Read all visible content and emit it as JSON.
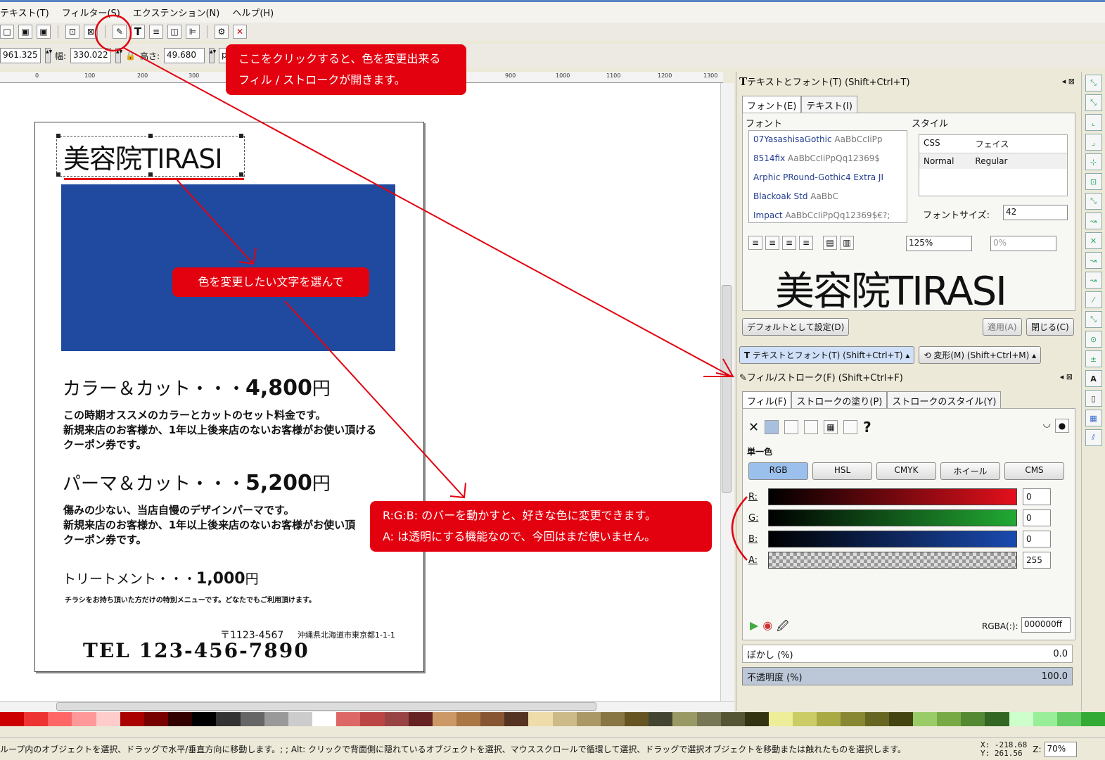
{
  "menu": [
    "テキスト(T)",
    "フィルター(S)",
    "エクステンション(N)",
    "ヘルプ(H)"
  ],
  "ctrl": {
    "x_value": "961.325",
    "w_label": "幅:",
    "w_value": "330.022",
    "h_label": "高さ:",
    "h_value": "49.680",
    "unit": "px"
  },
  "ruler": [
    "0",
    "100",
    "200",
    "300",
    "900",
    "1000",
    "1100",
    "1200",
    "1300"
  ],
  "flyer": {
    "title": "美容院TIRASI",
    "item1_name": "カラー＆カット・・・",
    "item1_price": "4,800",
    "yen": "円",
    "item1_desc1": "この時期オススメのカラーとカットのセット料金です。",
    "item1_desc2": "新規来店のお客様か、1年以上後来店のないお客様がお使い頂ける",
    "item1_desc3": "クーポン券です。",
    "item2_name": "パーマ＆カット・・・",
    "item2_price": "5,200",
    "item2_desc1": "傷みの少ない、当店自慢のデザインパーマです。",
    "item2_desc2": "新規来店のお客様か、1年以上後来店のないお客様がお使い頂",
    "item2_desc3": "クーポン券です。",
    "item3_name": "トリートメント・・・",
    "item3_price": "1,000",
    "item3_desc": "チラシをお持ち頂いた方だけの特別メニューです。どなたでもご利用頂けます。",
    "postal": "〒1123-4567",
    "address": "沖縄県北海道市東京都1-1-1",
    "tel": "TEL 123-456-7890"
  },
  "callouts": {
    "c1_l1": "ここをクリックすると、色を変更出来る",
    "c1_l2": "フィル / ストロークが開きます。",
    "c2": "色を変更したい文字を選んで",
    "c3_l1": "R:G:B: のバーを動かすと、好きな色に変更できます。",
    "c3_l2": "A: は透明にする機能なので、今回はまだ使いません。"
  },
  "text_panel": {
    "title": "テキストとフォント(T) (Shift+Ctrl+T)",
    "tab_font": "フォント(E)",
    "tab_text": "テキスト(I)",
    "font_label": "フォント",
    "style_label": "スタイル",
    "fonts": [
      {
        "name": "07YasashisaGothic",
        "sample": "AaBbCcIiPp"
      },
      {
        "name": "8514fix",
        "sample": "AaBbCcIiPpQq12369$"
      },
      {
        "name": "Arphic PRound-Gothic4 Extra JI",
        "sample": ""
      },
      {
        "name": "Blackoak Std",
        "sample": "AaBbC"
      },
      {
        "name": "Impact",
        "sample": "AaBbCcIiPpQq12369$€?;"
      }
    ],
    "style_css": "CSS",
    "style_face": "フェイス",
    "style_normal": "Normal",
    "style_regular": "Regular",
    "size_label": "フォントサイズ:",
    "size_value": "42",
    "spacing": "125%",
    "letter": "0%",
    "preview": "美容院TIRASI",
    "btn_default": "デフォルトとして設定(D)",
    "btn_apply": "適用(A)",
    "btn_close": "閉じる(C)"
  },
  "dock_tabs": {
    "t1": "テキストとフォント(T) (Shift+Ctrl+T)",
    "t2": "変形(M) (Shift+Ctrl+M)"
  },
  "fill_panel": {
    "title": "フィル/ストローク(F) (Shift+Ctrl+F)",
    "tab_fill": "フィル(F)",
    "tab_stroke_paint": "ストロークの塗り(P)",
    "tab_stroke_style": "ストロークのスタイル(Y)",
    "flat": "単一色",
    "modes": [
      "RGB",
      "HSL",
      "CMYK",
      "ホイール",
      "CMS"
    ],
    "channels": [
      {
        "label": "R:",
        "value": "0"
      },
      {
        "label": "G:",
        "value": "0"
      },
      {
        "label": "B:",
        "value": "0"
      },
      {
        "label": "A:",
        "value": "255"
      }
    ],
    "rgba_label": "RGBA(:):",
    "rgba_value": "000000ff",
    "blur_label": "ぼかし (%)",
    "blur_value": "0.0",
    "opacity_label": "不透明度 (%)",
    "opacity_value": "100.0",
    "unset": "?"
  },
  "status": {
    "text": "ループ内のオブジェクトを選択、ドラッグで水平/垂直方向に移動します。; ; Alt: クリックで背面側に隠れているオブジェクトを選択、マウススクロールで循環して選択、ドラッグで選択オブジェクトを移動または触れたものを選択します。",
    "x": "X: -218.68",
    "y": "Y:  261.56",
    "zoom_label": "Z:",
    "zoom": "70%"
  },
  "colors": {
    "accent": "#e3000f",
    "blue": "#1f4aa0"
  }
}
